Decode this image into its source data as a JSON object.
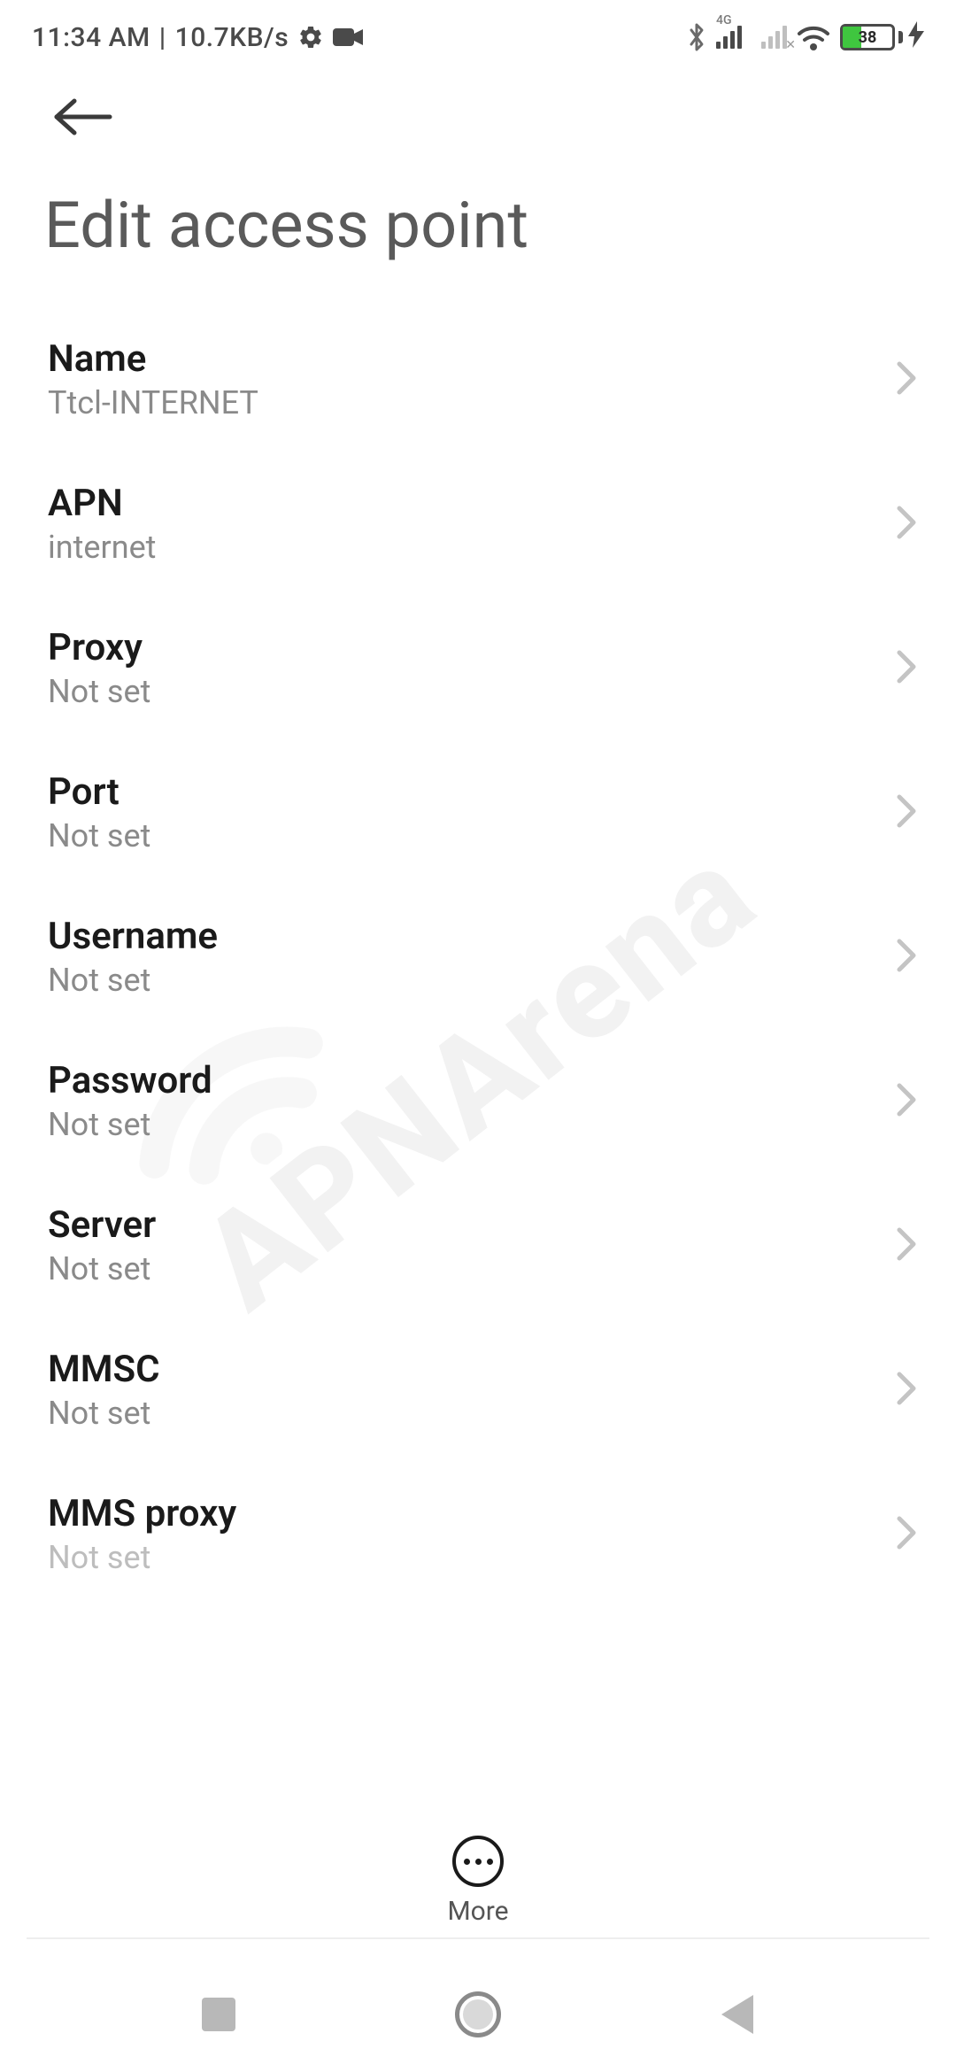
{
  "status_bar": {
    "time": "11:34 AM",
    "separator": "|",
    "net_speed": "10.7KB/s",
    "sim1_label": "4G",
    "battery_percent": "38",
    "battery_fill_pct": 38
  },
  "header": {
    "title": "Edit access point"
  },
  "settings": [
    {
      "label": "Name",
      "value": "Ttcl-INTERNET"
    },
    {
      "label": "APN",
      "value": "internet"
    },
    {
      "label": "Proxy",
      "value": "Not set"
    },
    {
      "label": "Port",
      "value": "Not set"
    },
    {
      "label": "Username",
      "value": "Not set"
    },
    {
      "label": "Password",
      "value": "Not set"
    },
    {
      "label": "Server",
      "value": "Not set"
    },
    {
      "label": "MMSC",
      "value": "Not set"
    },
    {
      "label": "MMS proxy",
      "value": "Not set"
    }
  ],
  "bottom_action": {
    "label": "More"
  },
  "watermark": "APNArena"
}
